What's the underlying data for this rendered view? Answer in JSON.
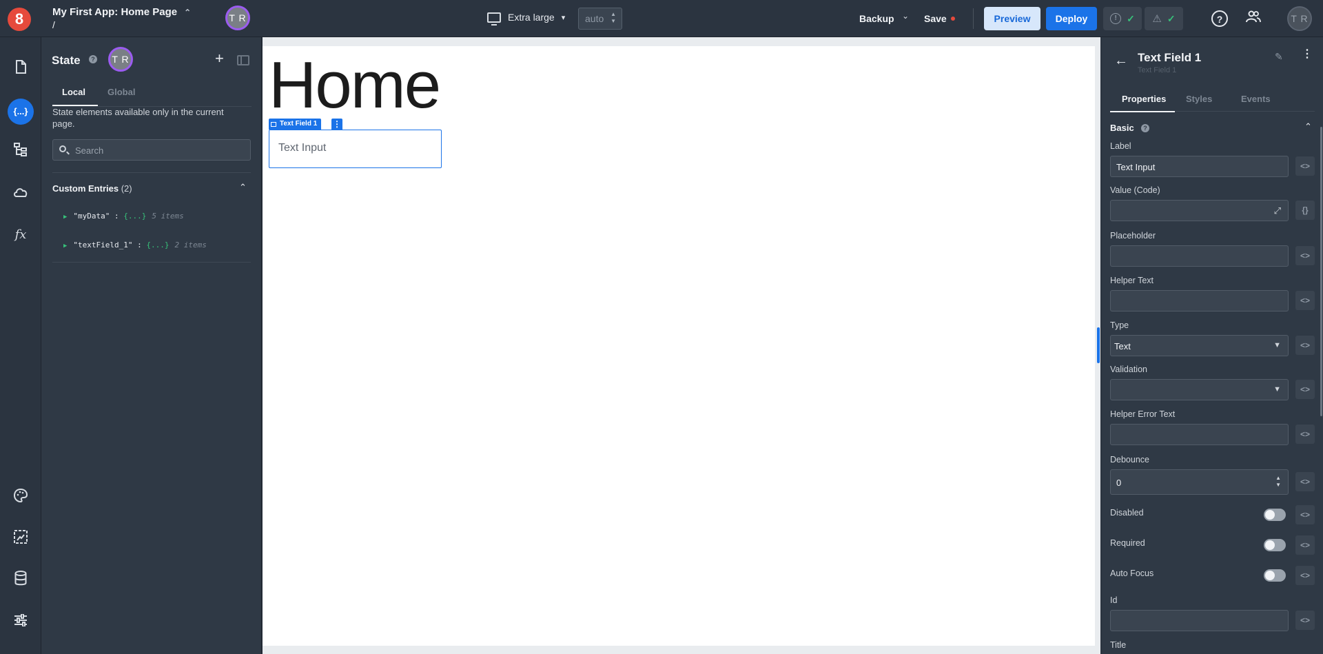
{
  "topbar": {
    "logo_text": "8",
    "app_title": "My First App: Home Page",
    "path": "/",
    "avatar_initials": "T R",
    "viewport_label": "Extra large",
    "width_value": "auto",
    "backup_label": "Backup",
    "save_label": "Save",
    "preview_label": "Preview",
    "deploy_label": "Deploy",
    "brand_color": "#1b73e8",
    "logo_color": "#e64a3c"
  },
  "rail": {
    "items": [
      {
        "icon": "page-icon"
      },
      {
        "icon": "state-icon",
        "label": "{...}",
        "active": true
      },
      {
        "icon": "tree-icon"
      },
      {
        "icon": "cloud-icon"
      },
      {
        "icon": "function-icon",
        "label": "fx"
      },
      {
        "icon": "palette-icon"
      },
      {
        "icon": "components-icon"
      },
      {
        "icon": "database-icon"
      },
      {
        "icon": "settings-sliders-icon"
      }
    ]
  },
  "state_panel": {
    "title": "State",
    "avatar_initials": "T R",
    "tabs": [
      "Local",
      "Global"
    ],
    "description": "State elements available only in the current page.",
    "search_placeholder": "Search",
    "custom_entries_label": "Custom Entries",
    "custom_entries_count": "(2)",
    "entries": [
      {
        "key": "\"myData\" : ",
        "value": "{...}",
        "meta": "5 items"
      },
      {
        "key": "\"textField_1\" : ",
        "value": "{...}",
        "meta": "2 items"
      }
    ]
  },
  "canvas": {
    "heading": "Home",
    "selected_badge": "Text Field 1",
    "text_field_value": "Text Input"
  },
  "properties": {
    "title": "Text Field 1",
    "subtitle": "Text Field 1",
    "tabs": [
      "Properties",
      "Styles",
      "Events"
    ],
    "section": "Basic",
    "fields": {
      "label": {
        "label": "Label",
        "value": "Text Input"
      },
      "value_code": {
        "label": "Value (Code)",
        "value": ""
      },
      "placeholder": {
        "label": "Placeholder",
        "value": ""
      },
      "helper_text": {
        "label": "Helper Text",
        "value": ""
      },
      "type": {
        "label": "Type",
        "value": "Text"
      },
      "validation": {
        "label": "Validation",
        "value": ""
      },
      "helper_error_text": {
        "label": "Helper Error Text",
        "value": ""
      },
      "debounce": {
        "label": "Debounce",
        "value": "0"
      },
      "disabled": {
        "label": "Disabled",
        "value": false
      },
      "required": {
        "label": "Required",
        "value": false
      },
      "auto_focus": {
        "label": "Auto Focus",
        "value": false
      },
      "id": {
        "label": "Id",
        "value": ""
      },
      "title": {
        "label": "Title"
      }
    }
  }
}
